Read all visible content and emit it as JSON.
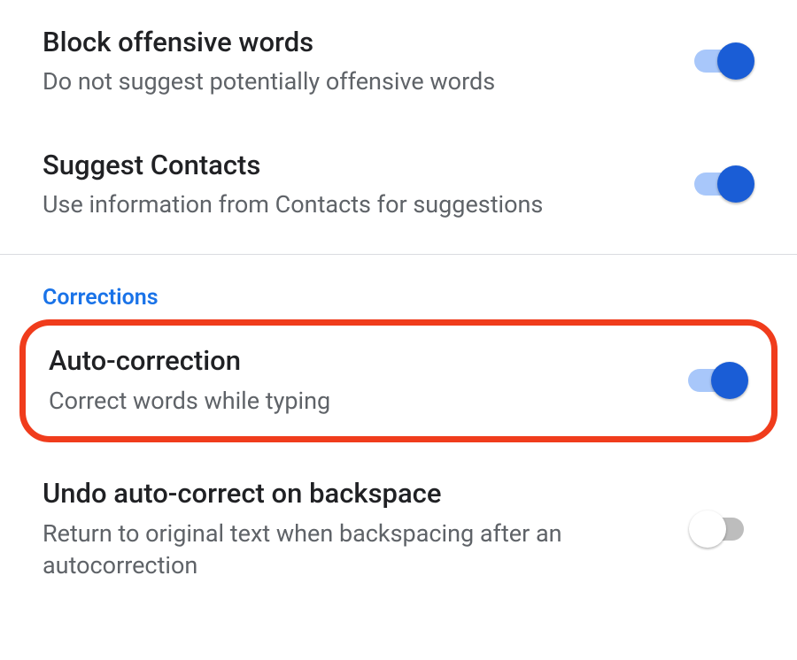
{
  "settings": {
    "block_offensive": {
      "title": "Block offensive words",
      "subtitle": "Do not suggest potentially offensive words",
      "enabled": true
    },
    "suggest_contacts": {
      "title": "Suggest Contacts",
      "subtitle": "Use information from Contacts for suggestions",
      "enabled": true
    },
    "auto_correction": {
      "title": "Auto-correction",
      "subtitle": "Correct words while typing",
      "enabled": true
    },
    "undo_autocorrect": {
      "title": "Undo auto-correct on backspace",
      "subtitle": "Return to original text when backspacing after an autocorrection",
      "enabled": false
    }
  },
  "sections": {
    "corrections": "Corrections"
  },
  "colors": {
    "accent": "#1a73e8",
    "toggle_on_thumb": "#1a5dd6",
    "toggle_on_track": "#a8c7fa",
    "highlight_border": "#f03c1c"
  }
}
